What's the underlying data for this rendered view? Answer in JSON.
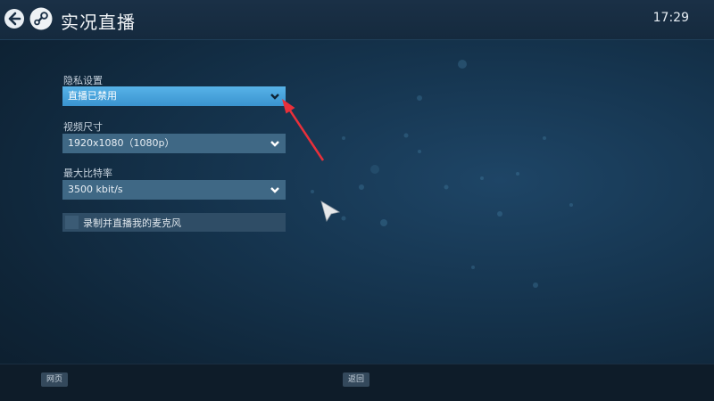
{
  "header": {
    "title": "实况直播",
    "clock": "17:29",
    "back_icon": "arrow-left-icon",
    "logo_icon": "steam-logo-icon"
  },
  "settings": {
    "privacy": {
      "label": "隐私设置",
      "value": "直播已禁用"
    },
    "video_size": {
      "label": "视频尺寸",
      "value": "1920x1080（1080p）"
    },
    "max_bitrate": {
      "label": "最大比特率",
      "value": "3500 kbit/s"
    },
    "microphone": {
      "label": "录制并直播我的麦克风",
      "checked": false
    }
  },
  "footer": {
    "left_button": "网页",
    "center_button": "返回"
  },
  "colors": {
    "accent": "#4ba8e0",
    "annotation": "#e8303a"
  }
}
